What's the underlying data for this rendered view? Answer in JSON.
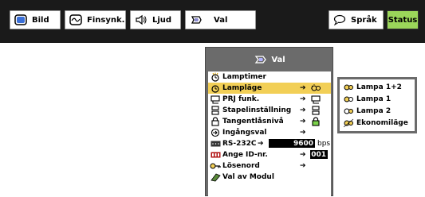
{
  "header": {
    "tabs": [
      {
        "label": "Bild",
        "icon": "picture-icon"
      },
      {
        "label": "Finsynk.",
        "icon": "fine-sync-icon"
      },
      {
        "label": "Ljud",
        "icon": "speaker-icon"
      },
      {
        "label": "Val",
        "icon": "options-icon"
      },
      {
        "label": "Språk",
        "icon": "speech-bubble-icon"
      },
      {
        "label": "Status",
        "icon": ""
      }
    ]
  },
  "menu": {
    "title": "Val",
    "items": [
      {
        "label": "Lamptimer"
      },
      {
        "label": "Lampläge",
        "arrow": "➔"
      },
      {
        "label": "PRJ funk.",
        "arrow": "➔"
      },
      {
        "label": "Stapelinställning",
        "arrow": "➔"
      },
      {
        "label": "Tangentlåsnivå",
        "arrow": "➔"
      },
      {
        "label": "Ingångsval",
        "arrow": "➔"
      },
      {
        "label": "RS-232C",
        "arrow": "➔",
        "value": "9600",
        "unit": "bps"
      },
      {
        "label": "Ange ID-nr.",
        "arrow": "➔",
        "value": "001"
      },
      {
        "label": "Lösenord",
        "arrow": "➔"
      },
      {
        "label": "Val av Modul"
      }
    ],
    "selected_index": 1
  },
  "submenu": {
    "items": [
      {
        "label": "Lampa 1+2"
      },
      {
        "label": "Lampa 1"
      },
      {
        "label": "Lampa 2"
      },
      {
        "label": "Ekonomiläge"
      }
    ]
  },
  "colors": {
    "header_bg": "#1a1a1a",
    "selected_row": "#f2cf56",
    "status_tab": "#9bd65a",
    "panel_frame": "#6b6b6b"
  }
}
